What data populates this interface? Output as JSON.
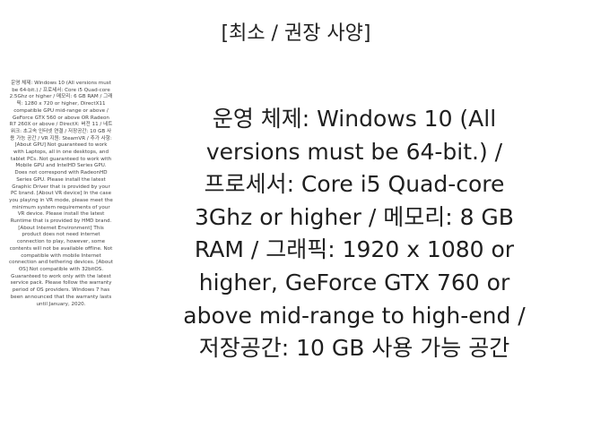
{
  "title": "[최소 / 권장 사양]",
  "sidebar_text": "운영 체제: Windows 10 (All versions must be 64-bit.) / 프로세서: Core i5 Quad-core 2.5Ghz or higher / 메모리: 6 GB RAM / 그래픽: 1280 x 720 or higher, DirectX11 compatible GPU mid-range or above / GeForce GTX 560 or above OR Radeon R7 260X or above / DirectX: 버전 11 / 네트워크: 초고속 인터넷 연결 / 저장공간: 10 GB 사용 가능 공간 / VR 지원: SteamVR / 추가 사항: [About GPU] Not guaranteed to work with Laptops, all in one desktops, and tablet PCs. Not guaranteed to work with Mobile GPU and IntelHD Series GPU. Does not correspond with RadeonHD Series GPU. Please install the latest Graphic Driver that is provided by your PC brand. [About VR device] In the case you playing in VR mode, please meet the minimum system requirements of your VR device. Please install the latest Runtime that is provided by HMD brand. [About Internet Environment] This product does not need internet connection to play, however, some contents will not be available offline. Not compatible with mobile Internet connection and tethering devices. [About OS] Not compatible with 32bitOS. Guaranteed to work only with the latest service pack. Please follow the warranty period of OS providers. Windows 7 has been announced that the warranty lasts until January, 2020.",
  "main_lines": [
    "운영 체제: Windows 10 (All",
    "versions must be 64-bit.) /",
    "프로세서: Core i5 Quad-core",
    "3Ghz or higher / 메모리: 8 GB",
    "RAM / 그래픽: 1920 x 1080 or",
    "higher, GeForce GTX 760 or",
    "above mid-range to high-end /",
    "저장공간: 10 GB 사용 가능 공간"
  ]
}
